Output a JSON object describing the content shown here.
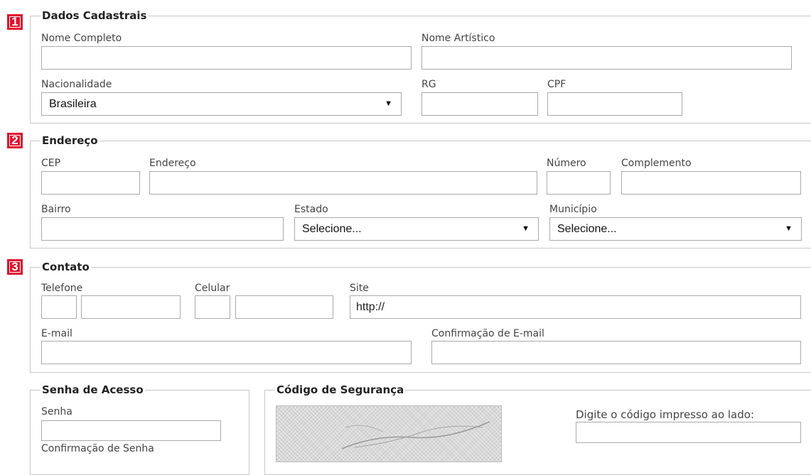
{
  "sections": {
    "s1": {
      "number": "1",
      "title": "Dados Cadastrais"
    },
    "s2": {
      "number": "2",
      "title": "Endereço"
    },
    "s3": {
      "number": "3",
      "title": "Contato"
    },
    "senha": {
      "title": "Senha de Acesso"
    },
    "codigo": {
      "title": "Código de Segurança"
    }
  },
  "dados": {
    "nome_completo": {
      "label": "Nome Completo",
      "value": ""
    },
    "nome_artistico": {
      "label": "Nome Artístico",
      "value": ""
    },
    "nacionalidade": {
      "label": "Nacionalidade",
      "selected": "Brasileira"
    },
    "rg": {
      "label": "RG",
      "value": ""
    },
    "cpf": {
      "label": "CPF",
      "value": ""
    }
  },
  "endereco": {
    "cep": {
      "label": "CEP",
      "value": ""
    },
    "endereco": {
      "label": "Endereço",
      "value": ""
    },
    "numero": {
      "label": "Número",
      "value": ""
    },
    "complemento": {
      "label": "Complemento",
      "value": ""
    },
    "bairro": {
      "label": "Bairro",
      "value": ""
    },
    "estado": {
      "label": "Estado",
      "selected": "Selecione..."
    },
    "municipio": {
      "label": "Município",
      "selected": "Selecione..."
    }
  },
  "contato": {
    "telefone": {
      "label": "Telefone",
      "ddd": "",
      "numero": ""
    },
    "celular": {
      "label": "Celular",
      "ddd": "",
      "numero": ""
    },
    "site": {
      "label": "Site",
      "value": "http://"
    },
    "email": {
      "label": "E-mail",
      "value": ""
    },
    "email_confirm": {
      "label": "Confirmação de E-mail",
      "value": ""
    }
  },
  "senha": {
    "senha": {
      "label": "Senha",
      "value": ""
    },
    "confirmacao": {
      "label": "Confirmação de Senha"
    }
  },
  "codigo": {
    "instruction": "Digite o código impresso ao lado:",
    "value": ""
  },
  "colors": {
    "badge": "#e0102d",
    "border": "#c8c8c8",
    "input_border": "#aaaaaa"
  },
  "icons": {
    "select_arrow": "▼"
  }
}
